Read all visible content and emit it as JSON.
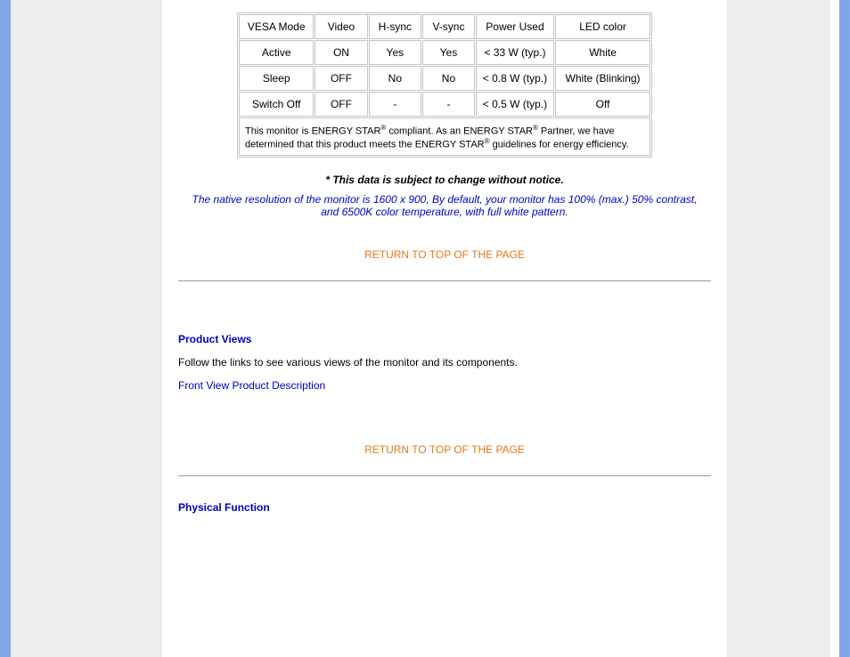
{
  "table": {
    "headers": [
      "VESA Mode",
      "Video",
      "H-sync",
      "V-sync",
      "Power Used",
      "LED color"
    ],
    "rows": [
      [
        "Active",
        "ON",
        "Yes",
        "Yes",
        "< 33 W (typ.)",
        "White"
      ],
      [
        "Sleep",
        "OFF",
        "No",
        "No",
        "< 0.8 W (typ.)",
        "White (Blinking)"
      ],
      [
        "Switch Off",
        "OFF",
        "-",
        "-",
        "< 0.5 W (typ.)",
        "Off"
      ]
    ],
    "footnote_prefix": "This monitor is ENERGY STAR",
    "footnote_mid1": " compliant. As an ENERGY STAR",
    "footnote_mid2": " Partner, we have determined that this product meets the ENERGY STAR",
    "footnote_suffix": " guidelines for energy efficiency."
  },
  "disclaimer": "* This data is subject to change without notice.",
  "resolution_note": "The native resolution of the monitor is 1600 x 900, By default, your monitor has 100% (max.) 50% contrast, and 6500K color temperature, with full white pattern.",
  "return_link": "RETURN TO TOP OF THE PAGE",
  "product_views": {
    "heading": "Product Views",
    "text": "Follow the links to see various views of the monitor and its components.",
    "link": "Front View Product Description"
  },
  "physical_function": {
    "heading": "Physical Function"
  }
}
